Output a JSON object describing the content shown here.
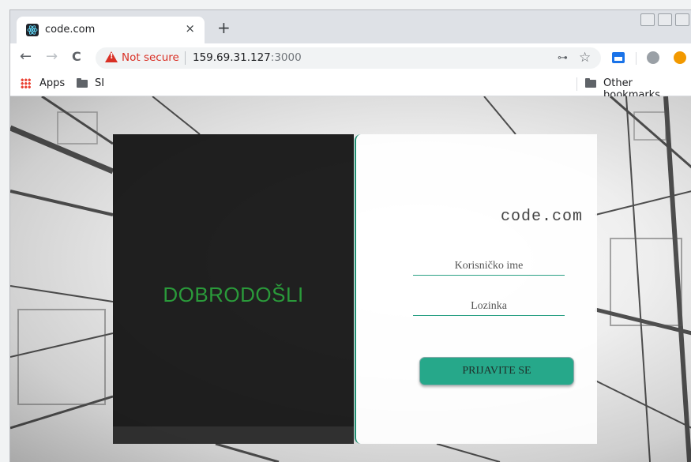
{
  "browser": {
    "tab": {
      "title": "code.com",
      "close_glyph": "×"
    },
    "new_tab_glyph": "+",
    "nav": {
      "back_glyph": "←",
      "forward_glyph": "→",
      "reload_glyph": "C"
    },
    "omnibox": {
      "security_label": "Not secure",
      "url_host": "159.69.31.127",
      "url_port": ":3000"
    },
    "star_glyph": "☆",
    "key_glyph": "⊶"
  },
  "bookmarks": {
    "apps_label": "Apps",
    "folder_label": "SI",
    "other_label": "Other bookmarks"
  },
  "page": {
    "welcome_text": "DOBRODOŠLI",
    "brand": "code.com",
    "username_placeholder": "Korisničko ime",
    "password_placeholder": "Lozinka",
    "login_button": "PRIJAVITE SE"
  },
  "colors": {
    "accent": "#26a88a",
    "welcome": "#2a9a3a",
    "warning": "#d93025"
  }
}
